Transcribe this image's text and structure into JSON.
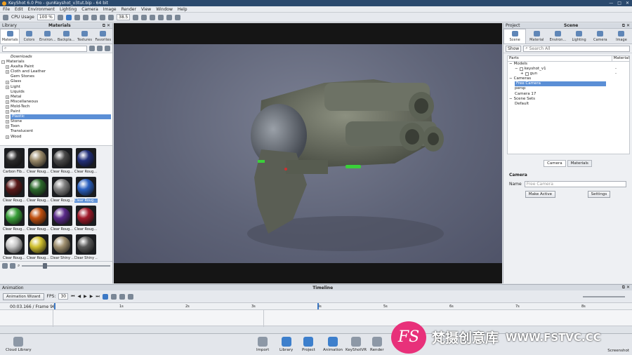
{
  "titlebar": {
    "title": "KeyShot 6.0 Pro - gunKeyshot_v3tut.bip - 64 bit"
  },
  "menu": [
    "File",
    "Edit",
    "Environment",
    "Lighting",
    "Camera",
    "Image",
    "Render",
    "View",
    "Window",
    "Help"
  ],
  "toolbar": {
    "cpu_label": "CPU Usage",
    "cpu_value": "100 %",
    "zoom_value": "38.5"
  },
  "library": {
    "panel_left": "Library",
    "panel_title": "Materials",
    "tabs": [
      "Materials",
      "Colors",
      "Environ...",
      "Backpla...",
      "Textures",
      "Favorites"
    ],
    "tree": [
      {
        "label": "Downloads",
        "italic": true,
        "exp": false,
        "indent": 1
      },
      {
        "label": "Materials",
        "exp": "−",
        "indent": 0
      },
      {
        "label": "Axalta Paint",
        "exp": "+",
        "indent": 1
      },
      {
        "label": "Cloth and Leather",
        "exp": "+",
        "indent": 1
      },
      {
        "label": "Gem Stones",
        "exp": false,
        "indent": 1
      },
      {
        "label": "Glass",
        "exp": "+",
        "indent": 1
      },
      {
        "label": "Light",
        "exp": "+",
        "indent": 1
      },
      {
        "label": "Liquids",
        "exp": false,
        "indent": 1
      },
      {
        "label": "Metal",
        "exp": "+",
        "indent": 1
      },
      {
        "label": "Miscellaneous",
        "exp": "+",
        "indent": 1
      },
      {
        "label": "Mold-Tech",
        "exp": "+",
        "indent": 1
      },
      {
        "label": "Paint",
        "exp": "+",
        "indent": 1
      },
      {
        "label": "Plastic",
        "exp": "+",
        "indent": 1,
        "selected": true
      },
      {
        "label": "Stone",
        "exp": "+",
        "indent": 1
      },
      {
        "label": "Toon",
        "exp": "+",
        "indent": 1
      },
      {
        "label": "Translucent",
        "exp": false,
        "indent": 1
      },
      {
        "label": "Wood",
        "exp": "+",
        "indent": 1
      }
    ],
    "thumbs": [
      {
        "cap": "Carbon Fib...",
        "c": "#2a2a2a"
      },
      {
        "cap": "Clear Roug...",
        "c": "#9a8a6a"
      },
      {
        "cap": "Clear Roug...",
        "c": "#4a4a4a"
      },
      {
        "cap": "Clear Roug...",
        "c": "#22307a"
      },
      {
        "cap": "Clear Roug...",
        "c": "#5a1a1a"
      },
      {
        "cap": "Clear Roug...",
        "c": "#2c6a2c"
      },
      {
        "cap": "Clear Roug...",
        "c": "#808080"
      },
      {
        "cap": "Clear Roug...",
        "c": "#2a60c0",
        "sel": true
      },
      {
        "cap": "Clear Roug...",
        "c": "#3aa03a"
      },
      {
        "cap": "Clear Roug...",
        "c": "#c05010"
      },
      {
        "cap": "Clear Roug...",
        "c": "#5a2a8a"
      },
      {
        "cap": "Clear Roug...",
        "c": "#a01a2a"
      },
      {
        "cap": "Clear Roug...",
        "c": "#c8c8c8"
      },
      {
        "cap": "Clear Roug...",
        "c": "#d0c030"
      },
      {
        "cap": "Clear Shiny ...",
        "c": "#a09070"
      },
      {
        "cap": "Clear Shiny ...",
        "c": "#5a5a5a"
      }
    ]
  },
  "scene": {
    "panel_left": "Project",
    "panel_title": "Scene",
    "tabs": [
      "Scene",
      "Material",
      "Environ...",
      "Lighting",
      "Camera",
      "Image"
    ],
    "show_label": "Show",
    "search_placeholder": "Search All",
    "parts_header": "Parts",
    "material_header": "Material",
    "rows": [
      {
        "label": "Models",
        "indent": 0,
        "exp": "−"
      },
      {
        "label": "keyshot_v1",
        "indent": 1,
        "exp": "−",
        "chk": true,
        "mat": "-"
      },
      {
        "label": "gun",
        "indent": 2,
        "exp": "+",
        "chk": true,
        "mat": "-"
      },
      {
        "label": "Cameras",
        "indent": 0,
        "exp": "−"
      },
      {
        "label": "Free Camera",
        "indent": 1,
        "sel": true
      },
      {
        "label": "persp",
        "indent": 1
      },
      {
        "label": "Camera 17",
        "indent": 1
      },
      {
        "label": "Scene Sets",
        "indent": 0,
        "exp": "−"
      },
      {
        "label": "Default",
        "indent": 1
      }
    ],
    "subtabs": [
      "Camera",
      "Materials"
    ],
    "camera_heading": "Camera",
    "name_label": "Name",
    "name_value": "Free Camera",
    "make_active": "Make Active",
    "settings": "Settings"
  },
  "animation": {
    "panel_left": "Animation",
    "panel_title": "Timeline",
    "wizard": "Animation Wizard",
    "fps_label": "FPS:",
    "fps_value": "30",
    "time": "00:03.166 / Frame 96",
    "ticks": [
      "1s",
      "2s",
      "3s",
      "4s",
      "5s",
      "6s",
      "7s",
      "8s"
    ]
  },
  "bottom": {
    "cloud": "Cloud Library",
    "items": [
      "Import",
      "Library",
      "Project",
      "Animation",
      "KeyShotVR",
      "Render"
    ],
    "screenshot": "Screenshot"
  },
  "watermark": {
    "logo": "FS",
    "cn": "梵摄创意库",
    "url": "WWW.FSTVC.CC"
  }
}
